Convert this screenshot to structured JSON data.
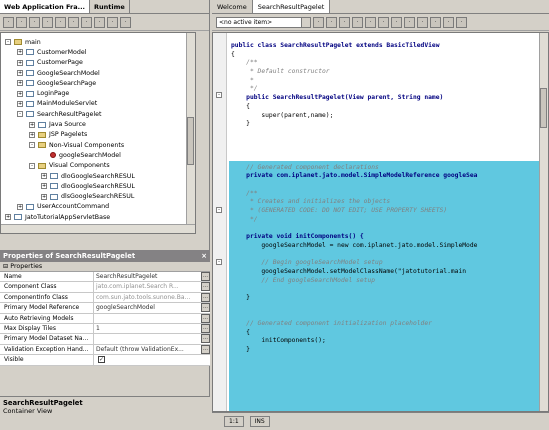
{
  "left_tabs": [
    "Web Application Fra...",
    "Runtime"
  ],
  "left_toolbar_icons": [
    "new-icon",
    "properties-icon",
    "cut-icon",
    "copy-icon",
    "paste-icon",
    "delete-icon",
    "up-icon",
    "down-icon",
    "run-icon",
    "stop-icon"
  ],
  "tree": [
    {
      "label": "main",
      "depth": 0,
      "exp": "-",
      "icon": "folder"
    },
    {
      "label": "CustomerModel",
      "depth": 1,
      "exp": "+",
      "icon": "page"
    },
    {
      "label": "CustomerPage",
      "depth": 1,
      "exp": "+",
      "icon": "page"
    },
    {
      "label": "GoogleSearchModel",
      "depth": 1,
      "exp": "+",
      "icon": "page"
    },
    {
      "label": "GoogleSearchPage",
      "depth": 1,
      "exp": "+",
      "icon": "page"
    },
    {
      "label": "LoginPage",
      "depth": 1,
      "exp": "+",
      "icon": "page"
    },
    {
      "label": "MainModuleServlet",
      "depth": 1,
      "exp": "+",
      "icon": "page"
    },
    {
      "label": "SearchResultPagelet",
      "depth": 1,
      "exp": "-",
      "icon": "page"
    },
    {
      "label": "Java Source",
      "depth": 2,
      "exp": "+",
      "icon": "page"
    },
    {
      "label": "JSP Pagelets",
      "depth": 2,
      "exp": "+",
      "icon": "folder"
    },
    {
      "label": "Non-Visual Components",
      "depth": 2,
      "exp": "-",
      "icon": "folder"
    },
    {
      "label": "googleSearchModel",
      "depth": 3,
      "exp": "",
      "icon": "red"
    },
    {
      "label": "Visual Components",
      "depth": 2,
      "exp": "-",
      "icon": "folder"
    },
    {
      "label": "dloGoogleSearchRESUL",
      "depth": 3,
      "exp": "+",
      "icon": "page"
    },
    {
      "label": "dloGoogleSearchRESUL",
      "depth": 3,
      "exp": "+",
      "icon": "page"
    },
    {
      "label": "dlsGoogleSearchRESUL",
      "depth": 3,
      "exp": "+",
      "icon": "page"
    },
    {
      "label": "UserAccountCommand",
      "depth": 1,
      "exp": "+",
      "icon": "page"
    },
    {
      "label": "JatoTutorialAppServletBase",
      "depth": 0,
      "exp": "+",
      "icon": "page"
    }
  ],
  "props": {
    "title": "Properties of SearchResultPagelet",
    "section": "Properties",
    "rows": [
      {
        "name": "Name",
        "value": "SearchResultPagelet",
        "muted": false,
        "button": true
      },
      {
        "name": "Component Class",
        "value": "jato.com.iplanet.Search R...",
        "muted": true,
        "button": true
      },
      {
        "name": "ComponentInfo Class",
        "value": "com.sun.jato.tools.sunone.Ba...",
        "muted": true,
        "button": true
      },
      {
        "name": "Primary Model Reference",
        "value": "googleSearchModel",
        "muted": false,
        "button": true
      },
      {
        "name": "Auto Retrieving Models",
        "value": "",
        "muted": false,
        "button": true
      },
      {
        "name": "Max Display Tiles",
        "value": "1",
        "muted": false,
        "button": true
      },
      {
        "name": "Primary Model Dataset Na...",
        "value": "",
        "muted": false,
        "button": true
      },
      {
        "name": "Validation Exception Hand...",
        "value": "Default (throw ValidationEx...",
        "muted": false,
        "button": true
      },
      {
        "name": "Visible",
        "value": "",
        "muted": false,
        "button": false,
        "checkbox": true
      }
    ]
  },
  "description": {
    "title": "SearchResultPagelet",
    "text": "Container View"
  },
  "editor_tabs": [
    "Welcome",
    "SearchResultPagelet"
  ],
  "editor_combo": "<no active item>",
  "editor_toolbar_icons": [
    "find-icon",
    "replace-icon",
    "bookmark-icon",
    "prev-icon",
    "next-icon",
    "indent-icon",
    "outdent-icon",
    "comment-icon",
    "uncomment-icon",
    "macro-icon",
    "record-icon",
    "stop-icon"
  ],
  "code_lines": [
    {
      "t": "public class SearchResultPagelet extends BasicTiledView",
      "c": "kw"
    },
    {
      "t": "{",
      "c": ""
    },
    {
      "t": "    /**",
      "c": "cm"
    },
    {
      "t": "     * Default constructor",
      "c": "cm"
    },
    {
      "t": "     *",
      "c": "cm"
    },
    {
      "t": "     */",
      "c": "cm"
    },
    {
      "t": "    public SearchResultPagelet(View parent, String name)",
      "c": "kw"
    },
    {
      "t": "    {",
      "c": ""
    },
    {
      "t": "        super(parent,name);",
      "c": ""
    },
    {
      "t": "    }",
      "c": ""
    },
    {
      "t": "",
      "c": ""
    },
    {
      "t": "",
      "c": ""
    },
    {
      "t": "",
      "c": ""
    },
    {
      "t": "",
      "c": ""
    },
    {
      "t": "    // Generated component declarations",
      "c": "cm"
    },
    {
      "t": "    private com.iplanet.jato.model.SimpleModelReference googleSea",
      "c": "kw"
    },
    {
      "t": "",
      "c": ""
    },
    {
      "t": "    /**",
      "c": "cm"
    },
    {
      "t": "     * Creates and initializes the objects",
      "c": "cm"
    },
    {
      "t": "     * (GENERATED CODE: DO NOT EDIT; USE PROPERTY SHEETS)",
      "c": "cm"
    },
    {
      "t": "     */",
      "c": "cm"
    },
    {
      "t": "",
      "c": ""
    },
    {
      "t": "    private void initComponents() {",
      "c": "kw"
    },
    {
      "t": "        googleSearchModel = new com.iplanet.jato.model.SimpleMode",
      "c": ""
    },
    {
      "t": "",
      "c": ""
    },
    {
      "t": "        // Begin googleSearchModel setup",
      "c": "cm"
    },
    {
      "t": "        googleSearchModel.setModelClassName(\"jatotutorial.main",
      "c": ""
    },
    {
      "t": "        // End googleSearchModel setup",
      "c": "cm"
    },
    {
      "t": "",
      "c": ""
    },
    {
      "t": "    }",
      "c": ""
    },
    {
      "t": "",
      "c": ""
    },
    {
      "t": "",
      "c": ""
    },
    {
      "t": "    // Generated component initialization placeholder",
      "c": "cm"
    },
    {
      "t": "    {",
      "c": ""
    },
    {
      "t": "        initComponents();",
      "c": ""
    },
    {
      "t": "    }",
      "c": ""
    }
  ],
  "status": {
    "pos": "1:1",
    "mode": "INS"
  }
}
